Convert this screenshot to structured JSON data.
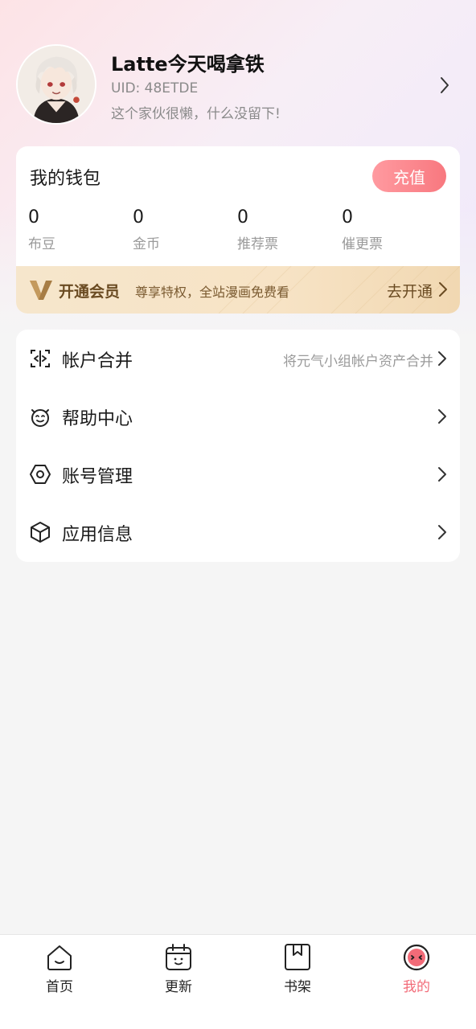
{
  "profile": {
    "nickname": "Latte今天喝拿铁",
    "uid": "UID: 48ETDE",
    "bio": "这个家伙很懒，什么没留下!"
  },
  "wallet": {
    "title": "我的钱包",
    "recharge_label": "充值",
    "stats": [
      {
        "value": "0",
        "label": "布豆"
      },
      {
        "value": "0",
        "label": "金币"
      },
      {
        "value": "0",
        "label": "推荐票"
      },
      {
        "value": "0",
        "label": "催更票"
      }
    ],
    "vip": {
      "title": "开通会员",
      "desc": "尊享特权，全站漫画免费看",
      "action": "去开通"
    }
  },
  "menu": {
    "items": [
      {
        "label": "帐户合并",
        "hint": "将元气小组帐户资产合并",
        "icon": "merge-account-icon"
      },
      {
        "label": "帮助中心",
        "hint": "",
        "icon": "help-robot-icon"
      },
      {
        "label": "账号管理",
        "hint": "",
        "icon": "settings-hexagon-icon"
      },
      {
        "label": "应用信息",
        "hint": "",
        "icon": "cube-icon"
      }
    ]
  },
  "tabbar": {
    "tabs": [
      {
        "label": "首页",
        "icon": "home-icon"
      },
      {
        "label": "更新",
        "icon": "calendar-icon"
      },
      {
        "label": "书架",
        "icon": "bookshelf-icon"
      },
      {
        "label": "我的",
        "icon": "profile-face-icon"
      }
    ],
    "active_index": 3
  },
  "colors": {
    "accent": "#f26b78",
    "vip_text": "#6a4b22",
    "vip_bg": "#f6e6cc"
  }
}
